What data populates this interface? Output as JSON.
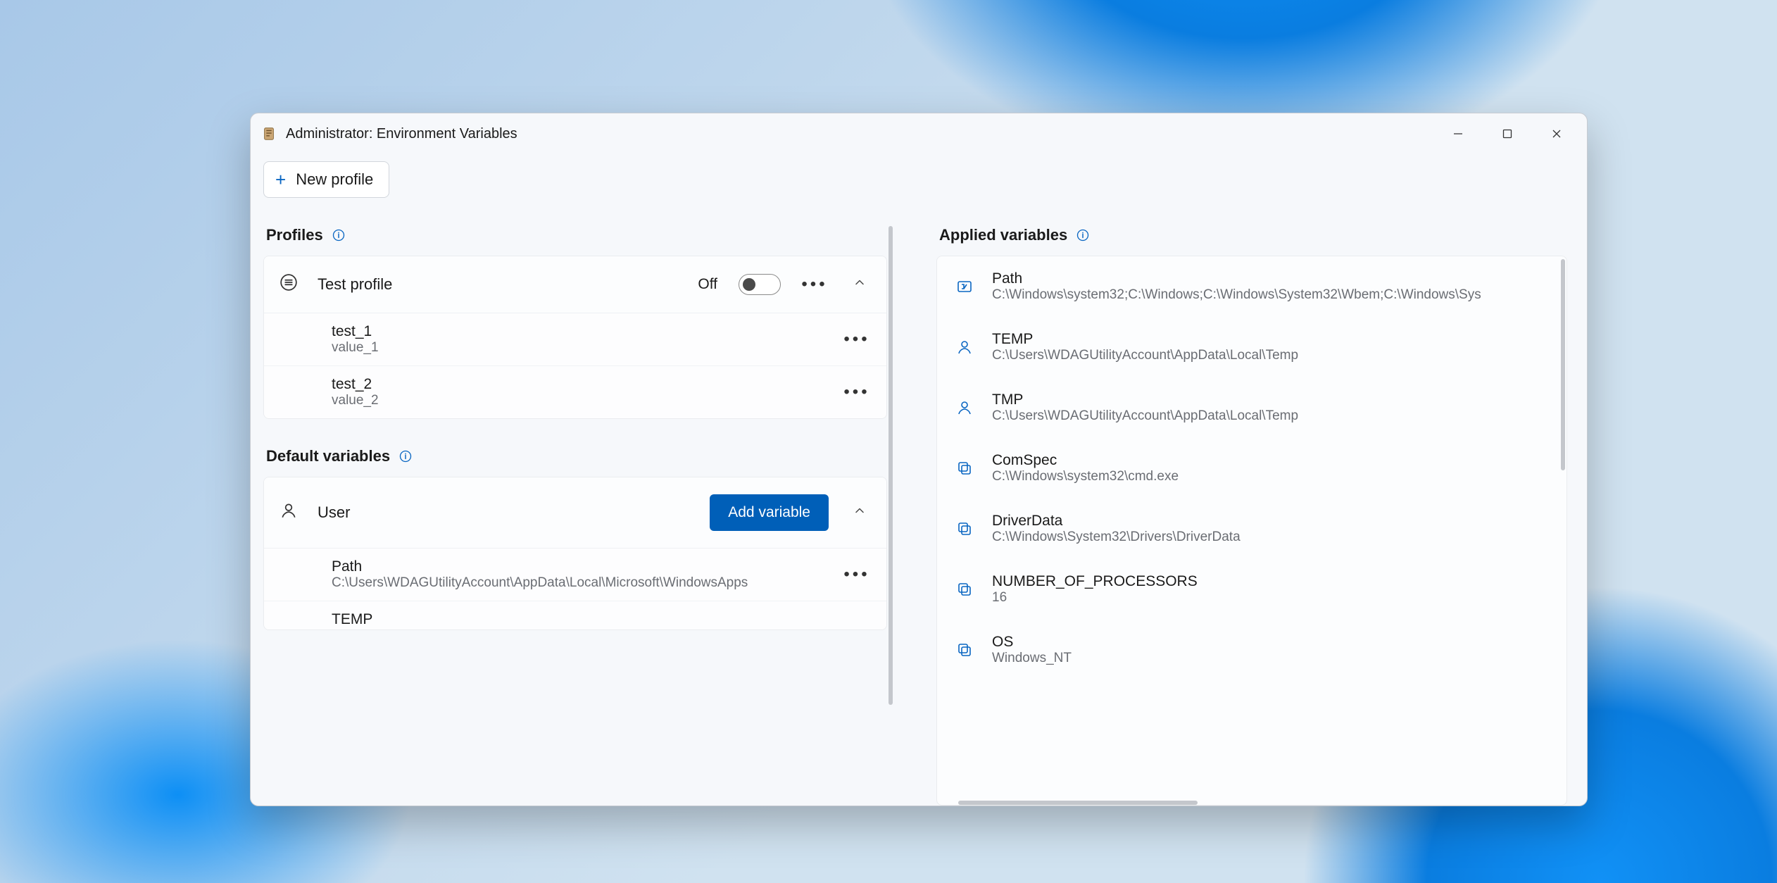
{
  "window": {
    "title": "Administrator: Environment Variables"
  },
  "toolbar": {
    "new_profile_label": "New profile"
  },
  "sections": {
    "profiles_label": "Profiles",
    "default_vars_label": "Default variables",
    "applied_vars_label": "Applied variables"
  },
  "profile": {
    "name": "Test profile",
    "toggle_state_label": "Off",
    "vars": [
      {
        "name": "test_1",
        "value": "value_1"
      },
      {
        "name": "test_2",
        "value": "value_2"
      }
    ]
  },
  "default_user": {
    "label": "User",
    "add_button": "Add variable",
    "vars": [
      {
        "name": "Path",
        "value": "C:\\Users\\WDAGUtilityAccount\\AppData\\Local\\Microsoft\\WindowsApps"
      },
      {
        "name": "TEMP",
        "value": ""
      }
    ]
  },
  "applied": [
    {
      "icon": "rename",
      "name": "Path",
      "value": "C:\\Windows\\system32;C:\\Windows;C:\\Windows\\System32\\Wbem;C:\\Windows\\Sys"
    },
    {
      "icon": "user",
      "name": "TEMP",
      "value": "C:\\Users\\WDAGUtilityAccount\\AppData\\Local\\Temp"
    },
    {
      "icon": "user",
      "name": "TMP",
      "value": "C:\\Users\\WDAGUtilityAccount\\AppData\\Local\\Temp"
    },
    {
      "icon": "copy",
      "name": "ComSpec",
      "value": "C:\\Windows\\system32\\cmd.exe"
    },
    {
      "icon": "copy",
      "name": "DriverData",
      "value": "C:\\Windows\\System32\\Drivers\\DriverData"
    },
    {
      "icon": "copy",
      "name": "NUMBER_OF_PROCESSORS",
      "value": "16"
    },
    {
      "icon": "copy",
      "name": "OS",
      "value": "Windows_NT"
    }
  ]
}
